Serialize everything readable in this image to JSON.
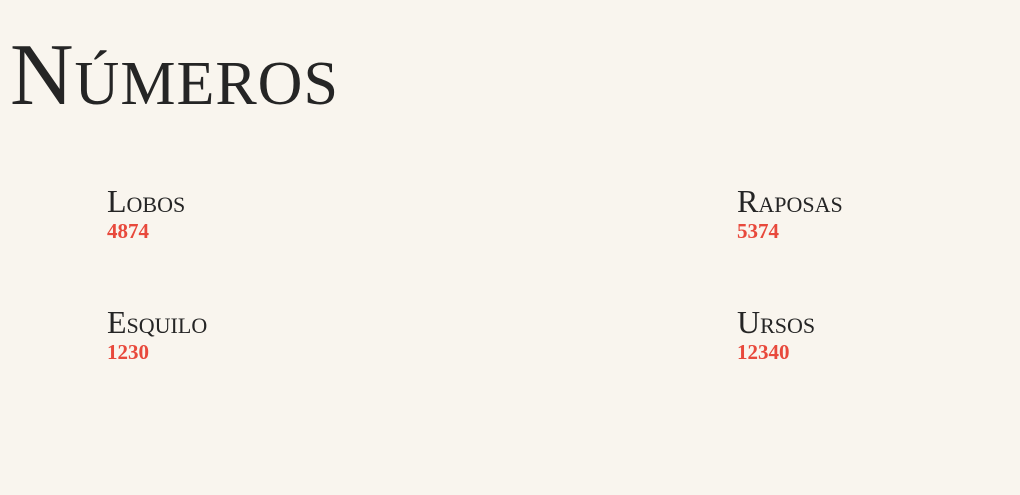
{
  "title": "Números",
  "stats": [
    {
      "label": "Lobos",
      "value": "4874"
    },
    {
      "label": "Raposas",
      "value": "5374"
    },
    {
      "label": "Esquilo",
      "value": "1230"
    },
    {
      "label": "Ursos",
      "value": "12340"
    }
  ],
  "colors": {
    "background": "#f9f5ee",
    "text": "#252525",
    "accent": "#e8493c"
  }
}
